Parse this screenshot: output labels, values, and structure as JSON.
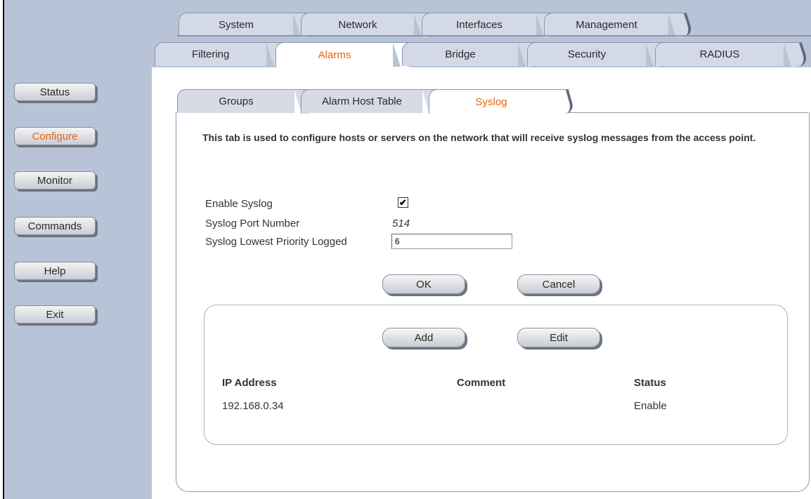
{
  "main_tabs_row1": [
    "System",
    "Network",
    "Interfaces",
    "Management"
  ],
  "main_tabs_row2": [
    "Filtering",
    "Alarms",
    "Bridge",
    "Security",
    "RADIUS"
  ],
  "active_main_tab": "Alarms",
  "sub_tabs": [
    "Groups",
    "Alarm Host Table",
    "Syslog"
  ],
  "active_sub_tab": "Syslog",
  "sidebar": {
    "items": [
      {
        "label": "Status"
      },
      {
        "label": "Configure"
      },
      {
        "label": "Monitor"
      },
      {
        "label": "Commands"
      },
      {
        "label": "Help"
      },
      {
        "label": "Exit"
      }
    ],
    "active": "Configure"
  },
  "description": "This tab is used to configure hosts or servers on the network that will receive syslog messages from the access point.",
  "form": {
    "enable_label": "Enable Syslog",
    "enable_checked": "✔",
    "port_label": "Syslog Port Number",
    "port_value": "514",
    "priority_label": "Syslog Lowest Priority Logged",
    "priority_value": "6"
  },
  "buttons": {
    "ok": "OK",
    "cancel": "Cancel",
    "add": "Add",
    "edit": "Edit"
  },
  "table": {
    "headers": [
      "IP Address",
      "Comment",
      "Status"
    ],
    "rows": [
      {
        "ip": "192.168.0.34",
        "comment": "",
        "status": "Enable"
      }
    ]
  },
  "colors": {
    "accent": "#e8660a",
    "nav_background": "#b8c3d8"
  }
}
